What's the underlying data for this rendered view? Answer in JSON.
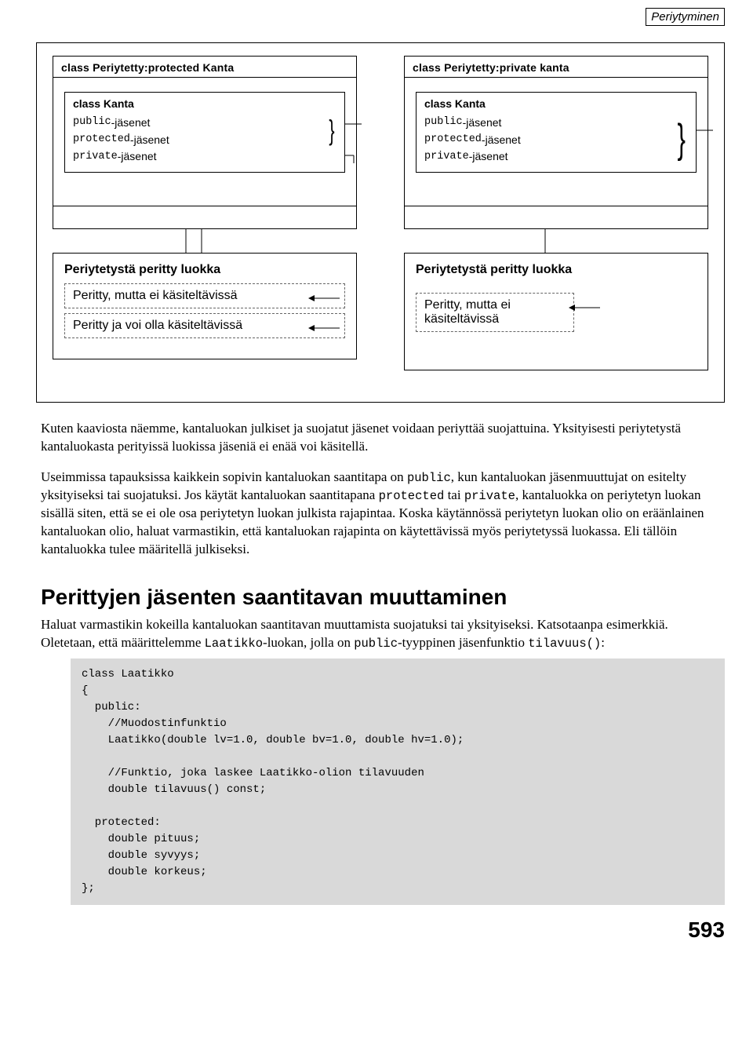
{
  "header": "Periytyminen",
  "diagram": {
    "left": {
      "outerTitle": "class Periytetty:protected Kanta",
      "innerTitle": "class Kanta",
      "members": [
        {
          "mod": "public",
          "rest": " -jäsenet"
        },
        {
          "mod": "protected",
          "rest": " -jäsenet"
        },
        {
          "mod": "private",
          "rest": " -jäsenet"
        }
      ],
      "lowerTitle": "Periytetystä peritty luokka",
      "note1": "Peritty, mutta ei käsiteltävissä",
      "note2": "Peritty ja voi olla käsiteltävissä"
    },
    "right": {
      "outerTitle": "class Periytetty:private kanta",
      "innerTitle": "class Kanta",
      "members": [
        {
          "mod": "public",
          "rest": " -jäsenet"
        },
        {
          "mod": "protected",
          "rest": " -jäsenet"
        },
        {
          "mod": "private",
          "rest": " -jäsenet"
        }
      ],
      "lowerTitle": "Periytetystä peritty luokka",
      "note1": "Peritty, mutta ei käsiteltävissä"
    }
  },
  "para1": "Kuten kaaviosta näemme, kantaluokan julkiset ja suojatut jäsenet voidaan periyttää suojattuina. Yksityisesti periytetystä kantaluokasta perityissä luokissa jäseniä ei enää voi käsitellä.",
  "para2a": "Useimmissa tapauksissa kaikkein sopivin kantaluokan saantitapa on ",
  "para2code1": "public",
  "para2b": ", kun kantaluokan jäsenmuuttujat on esitelty yksityiseksi tai suojatuksi. Jos käytät kantaluokan saantitapana ",
  "para2code2": "protected",
  "para2c": " tai ",
  "para2code3": "private",
  "para2d": ", kantaluokka on periytetyn luokan sisällä siten, että se ei ole osa periytetyn luokan julkista rajapintaa. Koska käytännössä periytetyn luokan olio on eräänlainen kantaluokan olio, haluat varmastikin, että kantaluokan rajapinta on käytettävissä myös periytetyssä luokassa. Eli tällöin kantaluokka tulee määritellä julkiseksi.",
  "h2": "Perittyjen jäsenten saantitavan muuttaminen",
  "para3a": "Haluat varmastikin kokeilla kantaluokan saantitavan muuttamista suojatuksi tai yksityiseksi. Katsotaanpa esimerkkiä. Oletetaan, että määrittelemme ",
  "para3code1": "Laatikko",
  "para3b": "-luokan, jolla on ",
  "para3code2": "public",
  "para3c": "-tyyppinen jäsenfunktio ",
  "para3code3": "tilavuus()",
  "para3d": ":",
  "code": "class Laatikko\n{\n  public:\n    //Muodostinfunktio\n    Laatikko(double lv=1.0, double bv=1.0, double hv=1.0);\n\n    //Funktio, joka laskee Laatikko-olion tilavuuden\n    double tilavuus() const;\n\n  protected:\n    double pituus;\n    double syvyys;\n    double korkeus;\n};",
  "pagenum": "593"
}
